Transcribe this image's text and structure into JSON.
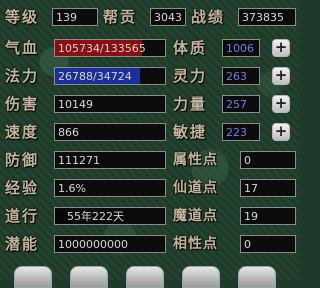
{
  "top": {
    "level_label": "等级",
    "level_value": "139",
    "contribution_label": "帮贡",
    "contribution_value": "3043",
    "merit_label": "战绩",
    "merit_value": "373835"
  },
  "stats_left": [
    {
      "label": "气血",
      "value": "105734/133565"
    },
    {
      "label": "法力",
      "value": "26788/34724"
    },
    {
      "label": "伤害",
      "value": "10149"
    },
    {
      "label": "速度",
      "value": "866"
    },
    {
      "label": "防御",
      "value": "111271"
    },
    {
      "label": "经验",
      "value": "1.6%"
    },
    {
      "label": "道行",
      "value": "55年222天"
    },
    {
      "label": "潜能",
      "value": "1000000000"
    }
  ],
  "stats_right": [
    {
      "label": "体质",
      "value": "1006"
    },
    {
      "label": "灵力",
      "value": "263"
    },
    {
      "label": "力量",
      "value": "257"
    },
    {
      "label": "敏捷",
      "value": "223"
    },
    {
      "label": "属性点",
      "value": "0"
    },
    {
      "label": "仙道点",
      "value": "17"
    },
    {
      "label": "魔道点",
      "value": "19"
    },
    {
      "label": "相性点",
      "value": "0"
    }
  ],
  "bars": {
    "hp_fill": 0.79,
    "mp_fill": 0.77,
    "hp_color": "#8a1010",
    "mp_color": "#1a2f9a"
  },
  "plus_label": "+",
  "icons": [
    "plus-icon"
  ]
}
